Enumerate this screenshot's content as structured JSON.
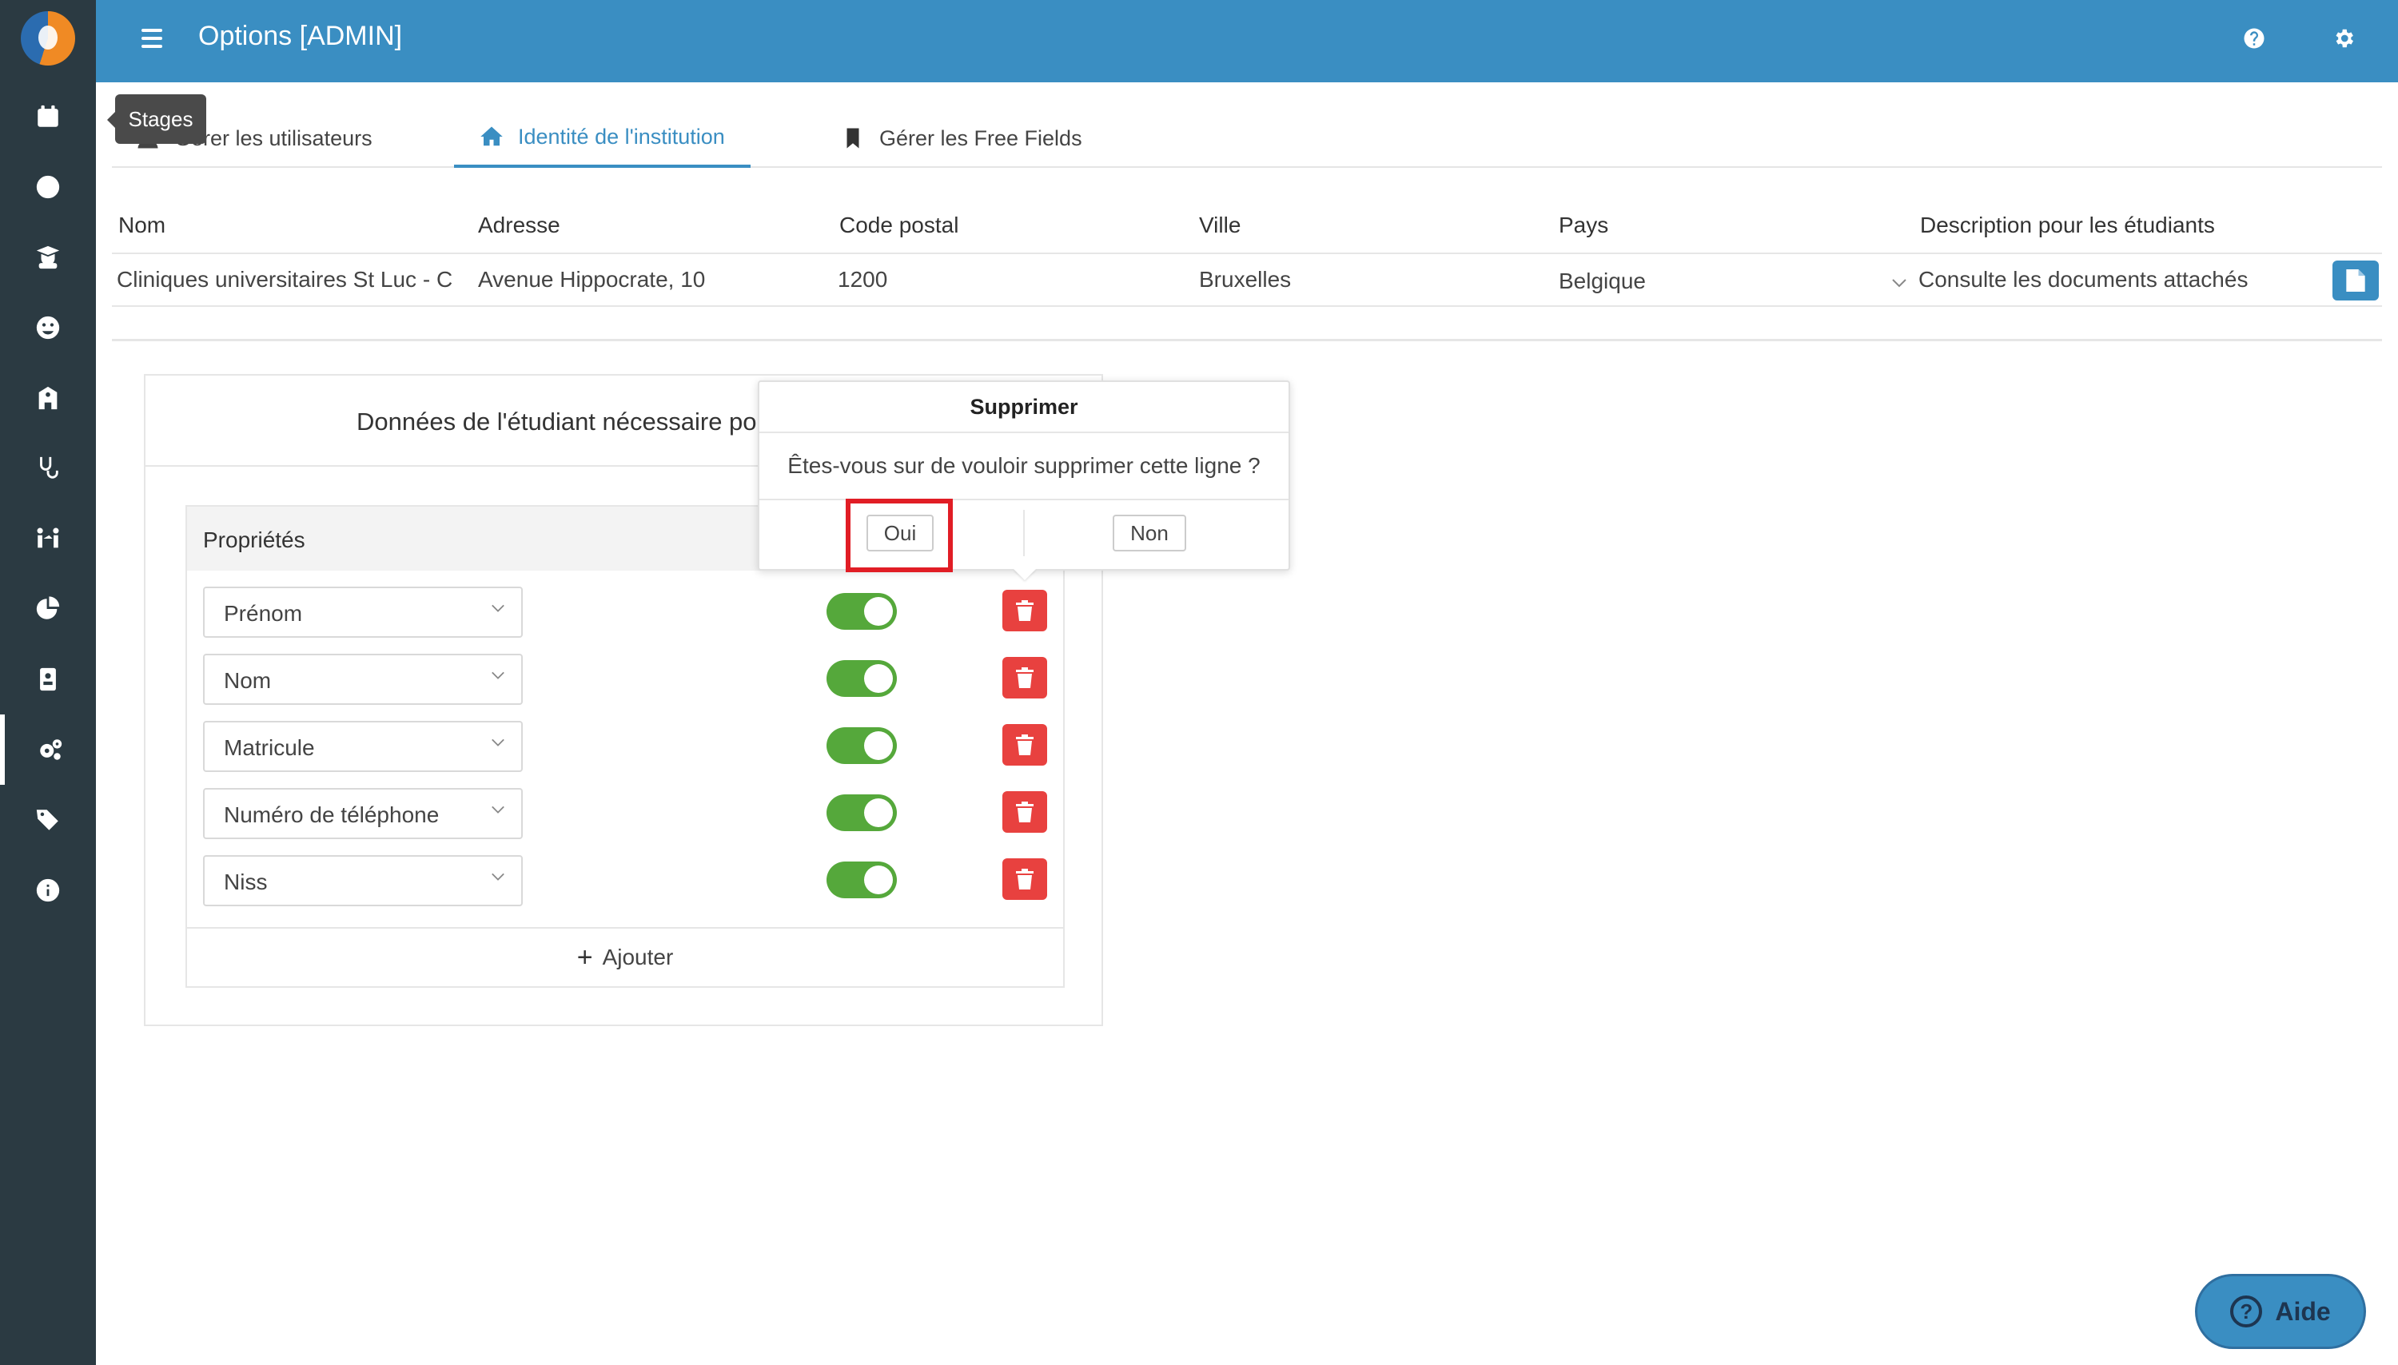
{
  "header": {
    "title": "Options [ADMIN]"
  },
  "tooltip": {
    "text": "Stages"
  },
  "tabs": [
    {
      "label": "Gérer les utilisateurs",
      "icon": "user-icon"
    },
    {
      "label": "Identité de l'institution",
      "icon": "home-icon",
      "active": true
    },
    {
      "label": "Gérer les Free Fields",
      "icon": "bookmark-icon"
    }
  ],
  "table": {
    "headers": [
      "Nom",
      "Adresse",
      "Code postal",
      "Ville",
      "Pays",
      "Description pour les étudiants"
    ],
    "row": {
      "nom": "Cliniques universitaires St Luc - Ce",
      "adresse": "Avenue Hippocrate, 10",
      "code_postal": "1200",
      "ville": "Bruxelles",
      "pays": "Belgique",
      "description": "Consulte les documents attachés"
    }
  },
  "card": {
    "title": "Données de l'étudiant nécessaire po",
    "properties_header": "Propriétés",
    "properties": [
      {
        "label": "Prénom",
        "enabled": true
      },
      {
        "label": "Nom",
        "enabled": true
      },
      {
        "label": "Matricule",
        "enabled": true
      },
      {
        "label": "Numéro de téléphone",
        "enabled": true
      },
      {
        "label": "Niss",
        "enabled": true
      }
    ],
    "add_label": "Ajouter"
  },
  "popover": {
    "title": "Supprimer",
    "message": "Êtes-vous sur de vouloir supprimer cette ligne ?",
    "yes": "Oui",
    "no": "Non"
  },
  "help_button": {
    "label": "Aide",
    "icon": "help-circle-icon"
  },
  "colors": {
    "topbar": "#3a8ec2",
    "sidebar": "#2b3a42",
    "toggle_on": "#55a83b",
    "delete": "#e8413f",
    "highlight": "#e11d25"
  },
  "sidebar_icons": [
    "calendar-icon",
    "clock-icon",
    "graduate-icon",
    "smiley-icon",
    "institution-icon",
    "stethoscope-icon",
    "transfer-icon",
    "pie-chart-icon",
    "badge-icon",
    "gears-icon",
    "tags-icon",
    "info-icon"
  ]
}
